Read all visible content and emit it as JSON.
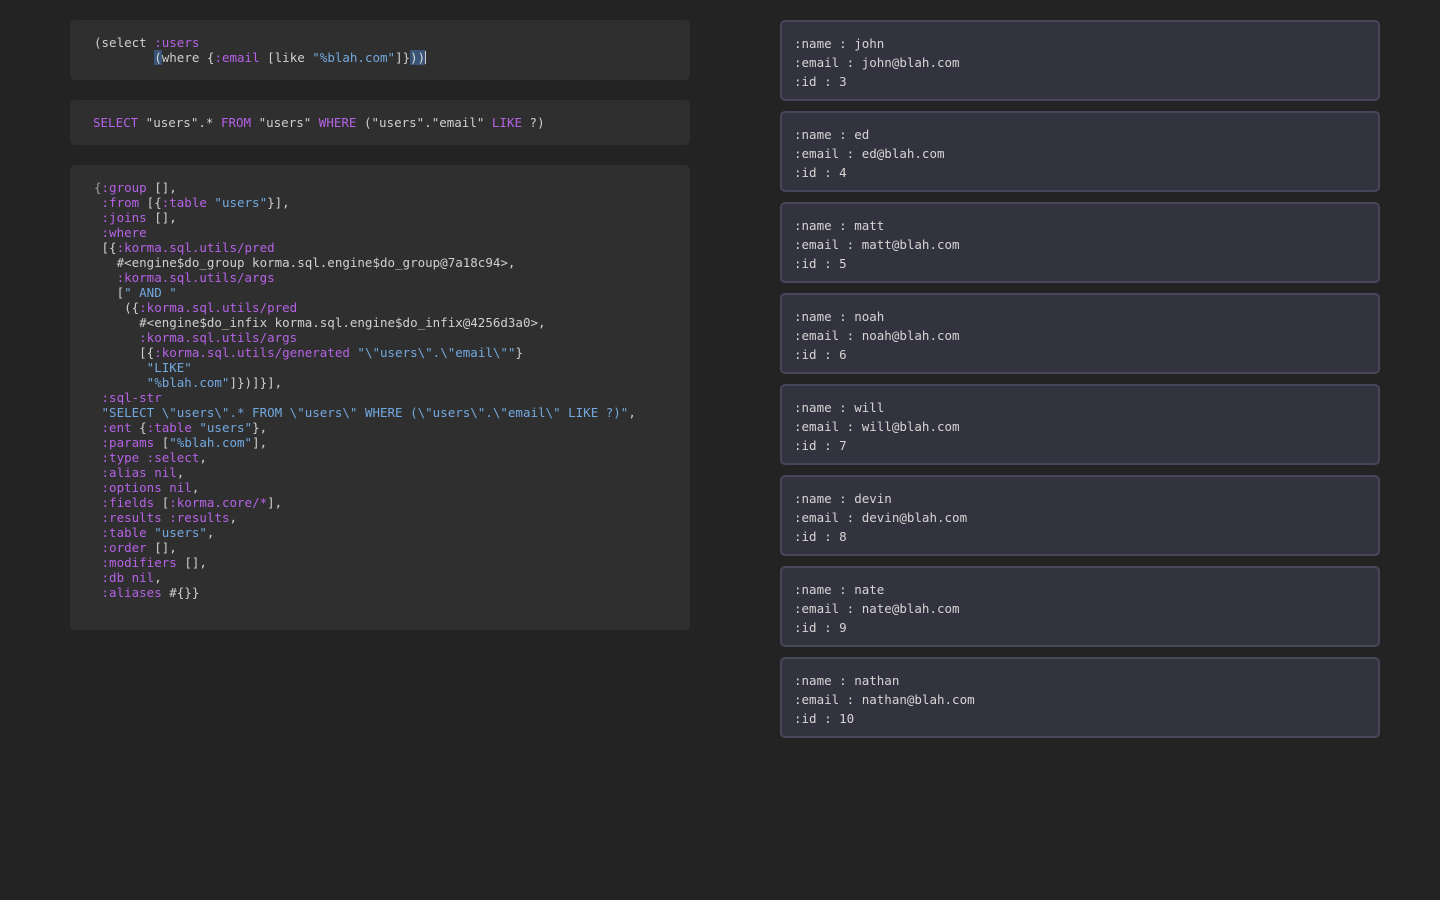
{
  "query": {
    "line1_open": "(select ",
    "line1_kw": ":users",
    "line2_indent": "        ",
    "line2_open_paren": "(",
    "line2_where": "where {",
    "line2_email_kw": ":email",
    "line2_like_open": " [like ",
    "line2_str": "\"%blah.com\"",
    "line2_close": "]}",
    "line2_close_hl": "))",
    "line2_cursor": ""
  },
  "sql": {
    "select": "SELECT",
    "p1": " \"users\".* ",
    "from": "FROM",
    "p2": " \"users\" ",
    "where": "WHERE",
    "p3": " (\"users\".\"email\" ",
    "like": "LIKE",
    "p4": " ?)"
  },
  "map": {
    "l1a": "{",
    "l1k": ":group",
    "l1b": " [],",
    "l2k": " :from",
    "l2b": " [{",
    "l2k2": ":table",
    "l2s": " \"users\"",
    "l2c": "}],",
    "l3k": " :joins",
    "l3b": " [],",
    "l4k": " :where",
    "l5a": " [{",
    "l5k": ":korma.sql.utils/pred",
    "l6": "   #<engine$do_group korma.sql.engine$do_group@7a18c94>,",
    "l7k": "   :korma.sql.utils/args",
    "l8a": "   [",
    "l8s": "\" AND \"",
    "l9a": "    ({",
    "l9k": ":korma.sql.utils/pred",
    "l10": "      #<engine$do_infix korma.sql.engine$do_infix@4256d3a0>,",
    "l11k": "      :korma.sql.utils/args",
    "l12a": "      [{",
    "l12k": ":korma.sql.utils/generated",
    "l12s": " \"\\\"users\\\".\\\"email\\\"\"",
    "l12c": "}",
    "l13s": "       \"LIKE\"",
    "l14s": "       \"%blah.com\"",
    "l14c": "]})]}],",
    "l15k": " :sql-str",
    "l16s": " \"SELECT \\\"users\\\".* FROM \\\"users\\\" WHERE (\\\"users\\\".\\\"email\\\" LIKE ?)\"",
    "l16c": ",",
    "l17k": " :ent",
    "l17a": " {",
    "l17k2": ":table",
    "l17s": " \"users\"",
    "l17c": "},",
    "l18k": " :params",
    "l18a": " [",
    "l18s": "\"%blah.com\"",
    "l18c": "],",
    "l19k": " :type",
    "l19k2": " :select",
    "l19c": ",",
    "l20k": " :alias",
    "l20v": " nil",
    "l20c": ",",
    "l21k": " :options",
    "l21v": " nil",
    "l21c": ",",
    "l22k": " :fields",
    "l22a": " [",
    "l22k2": ":korma.core/*",
    "l22c": "],",
    "l23k": " :results",
    "l23k2": " :results",
    "l23c": ",",
    "l24k": " :table",
    "l24s": " \"users\"",
    "l24c": ",",
    "l25k": " :order",
    "l25b": " [],",
    "l26k": " :modifiers",
    "l26b": " [],",
    "l27k": " :db",
    "l27v": " nil",
    "l27c": ",",
    "l28k": " :aliases",
    "l28b": " #{}}"
  },
  "results": [
    {
      "name": ":name : john",
      "email": ":email : john@blah.com",
      "id": ":id : 3"
    },
    {
      "name": ":name : ed",
      "email": ":email : ed@blah.com",
      "id": ":id : 4"
    },
    {
      "name": ":name : matt",
      "email": ":email : matt@blah.com",
      "id": ":id : 5"
    },
    {
      "name": ":name : noah",
      "email": ":email : noah@blah.com",
      "id": ":id : 6"
    },
    {
      "name": ":name : will",
      "email": ":email : will@blah.com",
      "id": ":id : 7"
    },
    {
      "name": ":name : devin",
      "email": ":email : devin@blah.com",
      "id": ":id : 8"
    },
    {
      "name": ":name : nate",
      "email": ":email : nate@blah.com",
      "id": ":id : 9"
    },
    {
      "name": ":name : nathan",
      "email": ":email : nathan@blah.com",
      "id": ":id : 10"
    }
  ],
  "colors": {
    "keyword": "#b562e6",
    "string": "#73a8df",
    "text": "#cfcfcf",
    "background": "#232323",
    "panel": "#2f2f2f",
    "result_card": "#33333f"
  }
}
